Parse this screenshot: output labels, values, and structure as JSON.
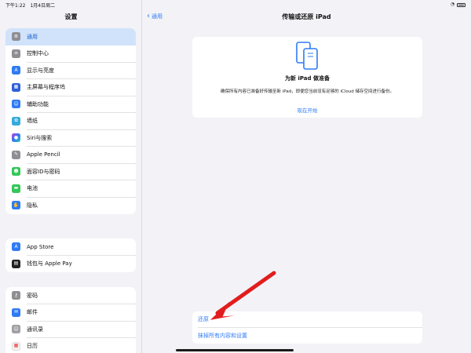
{
  "status_bar": {
    "time": "下午1:22",
    "date": "1月4日周二"
  },
  "sidebar": {
    "title": "设置",
    "groups": [
      [
        {
          "label": "通用",
          "icon": "gear-icon",
          "color": "#8e8e93",
          "selected": true
        },
        {
          "label": "控制中心",
          "icon": "toggles-icon",
          "color": "#8e8e93"
        },
        {
          "label": "显示与亮度",
          "icon": "text-size-icon",
          "color": "#2f7bf5"
        },
        {
          "label": "主屏幕与程序坞",
          "icon": "grid-icon",
          "color": "#2f5fd8"
        },
        {
          "label": "辅助功能",
          "icon": "accessibility-icon",
          "color": "#2f7bf5"
        },
        {
          "label": "墙纸",
          "icon": "flower-icon",
          "color": "#35aadc"
        },
        {
          "label": "Siri与搜索",
          "icon": "siri-icon",
          "color": "#222"
        },
        {
          "label": "Apple Pencil",
          "icon": "pencil-icon",
          "color": "#8e8e93"
        },
        {
          "label": "面容ID与密码",
          "icon": "face-id-icon",
          "color": "#34c759"
        },
        {
          "label": "电池",
          "icon": "battery-icon",
          "color": "#34c759"
        },
        {
          "label": "隐私",
          "icon": "hand-icon",
          "color": "#2f7bf5"
        }
      ],
      [
        {
          "label": "App Store",
          "icon": "app-store-icon",
          "color": "#2f7bf5"
        },
        {
          "label": "钱包与 Apple Pay",
          "icon": "wallet-icon",
          "color": "#222"
        }
      ],
      [
        {
          "label": "密码",
          "icon": "key-icon",
          "color": "#8e8e93"
        },
        {
          "label": "邮件",
          "icon": "mail-icon",
          "color": "#2f7bf5"
        },
        {
          "label": "通讯录",
          "icon": "contacts-icon",
          "color": "#a0a0a5"
        },
        {
          "label": "日历",
          "icon": "calendar-icon",
          "color": "#f2f2f2"
        }
      ]
    ]
  },
  "main": {
    "back_label": "通用",
    "title": "传输或还原 iPad",
    "card": {
      "heading": "为新 iPad 做准备",
      "description": "确保所有内容已准备好传输至新 iPad，即便您当前没有足够的 iCloud 储存空间进行备份。",
      "action": "现在开始",
      "icon": "devices-icon"
    },
    "bottom_items": [
      "还原",
      "抹掉所有内容和设置"
    ]
  },
  "colors": {
    "accent": "#2f7bf5",
    "selected_bg": "#d1e3fb",
    "arrow": "#e11d1d"
  }
}
